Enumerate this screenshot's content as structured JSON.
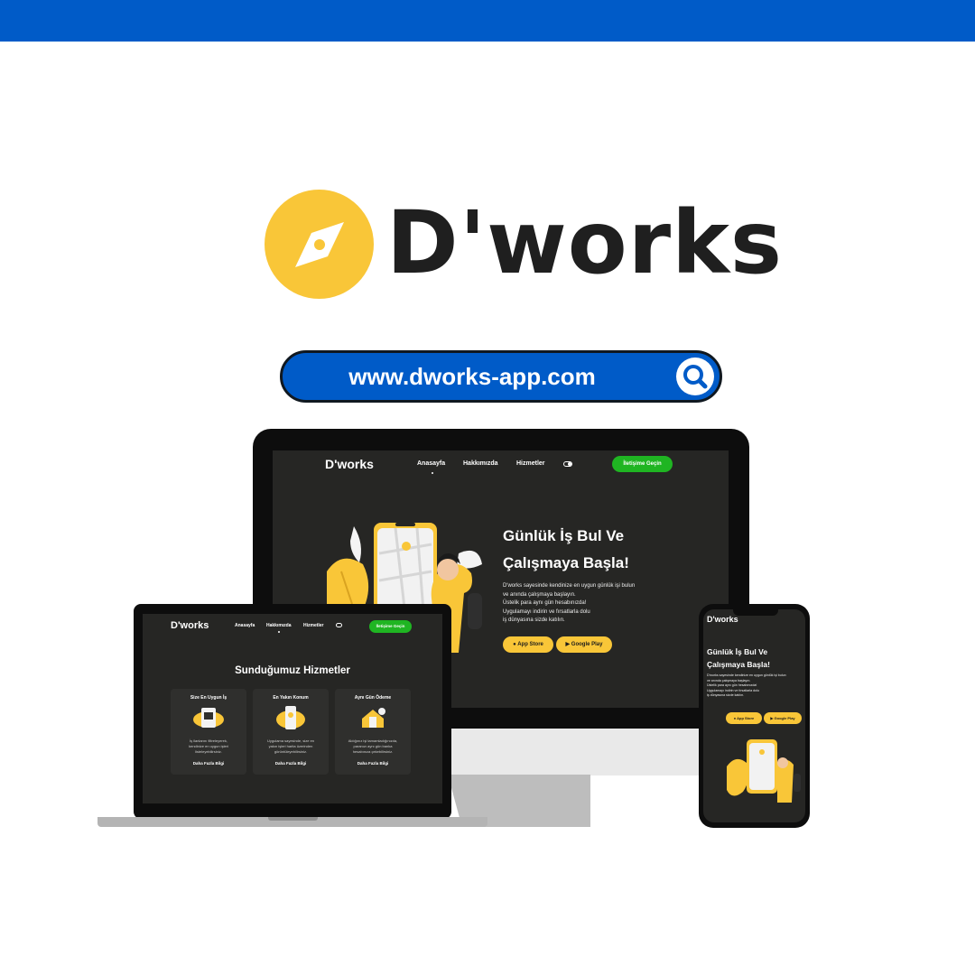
{
  "brand": {
    "name": "D'works",
    "url": "www.dworks-app.com",
    "colors": {
      "primary_blue": "#005BC8",
      "accent_yellow": "#F9C638",
      "cta_green": "#1fb522",
      "screen_bg": "#262624"
    }
  },
  "icons": {
    "logo": "compass-icon",
    "search": "search-icon",
    "theme_toggle": "toggle-icon",
    "apple": "apple-icon",
    "google_play": "play-icon"
  },
  "site": {
    "nav": {
      "logo": "D'works",
      "links": [
        "Anasayfa",
        "Hakkımızda",
        "Hizmetler"
      ],
      "cta": "İletişime Geçin"
    },
    "hero": {
      "title_line1": "Günlük İş Bul Ve",
      "title_line2": "Çalışmaya Başla!",
      "lines": [
        "D'works sayesinde kendinize en uygun günlük işi bulun",
        "ve anında çalışmaya başlayın.",
        "Üstelik para aynı gün hesabınızda!",
        "Uygulamayı indirin ve fırsatlarla dolu",
        "iş dünyasına sizde katılın."
      ],
      "store_apple": "App Store",
      "store_google": "Google Play"
    },
    "services": {
      "title": "Sunduğumuz Hizmetler",
      "cards": [
        {
          "title": "Size En Uygun İş",
          "lines": [
            "İş ilanlarını filtreleyerek,",
            "kendinize en uygun işleri",
            "listeleyebilirsiniz."
          ],
          "link": "Daha Fazla Bilgi"
        },
        {
          "title": "En Yakın Konum",
          "lines": [
            "Uygulama sayesinde, size en",
            "yakın işleri harita üzerinden",
            "görüntüleyebilirsiniz."
          ],
          "link": "Daha Fazla Bilgi"
        },
        {
          "title": "Aynı Gün Ödeme",
          "lines": [
            "Aldığınız işi tamamladığınızda,",
            "paranızı aynı gün banka",
            "hesabınıza çekebilirsiniz."
          ],
          "link": "Daha Fazla Bilgi"
        }
      ]
    }
  }
}
